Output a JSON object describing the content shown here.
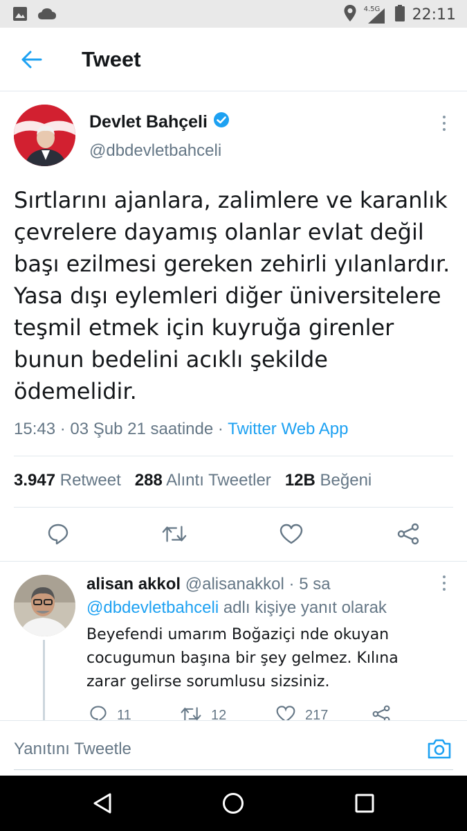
{
  "status_bar": {
    "network": "4.5G",
    "time": "22:11"
  },
  "app_bar": {
    "title": "Tweet"
  },
  "tweet": {
    "author_name": "Devlet Bahçeli",
    "author_handle": "@dbdevletbahceli",
    "text": "Sırtlarını ajanlara, zalimlere ve karanlık çevrelere dayamış olanlar evlat değil başı ezilmesi gereken zehirli yılanlardır. Yasa dışı eylemleri diğer üniversitelere teşmil etmek için kuyruğa girenler bunun bedelini acıklı şekilde ödemelidir.",
    "timestamp": "15:43 · 03 Şub 21 saatinde · ",
    "source": "Twitter Web App",
    "stats": [
      {
        "count": "3.947",
        "label": "Retweet"
      },
      {
        "count": "288",
        "label": "Alıntı Tweetler"
      },
      {
        "count": "12B",
        "label": "Beğeni"
      }
    ]
  },
  "reply": {
    "author_name": "alisan akkol",
    "author_handle": "@alisanakkol",
    "separator": " · ",
    "time_ago": "5 sa",
    "reply_to_mention": "@dbdevletbahceli",
    "reply_to_suffix": " adlı kişiye yanıt olarak",
    "text": "Beyefendi umarım Boğaziçi nde okuyan cocugumun başına bir şey gelmez. Kılına zarar gelirse sorumlusu sizsiniz.",
    "reply_count": "11",
    "retweet_count": "12",
    "like_count": "217"
  },
  "compose": {
    "placeholder": "Yanıtını Tweetle"
  },
  "colors": {
    "accent": "#1da1f2",
    "text_primary": "#14171a",
    "text_secondary": "#657786",
    "divider": "#e1e8ed"
  }
}
